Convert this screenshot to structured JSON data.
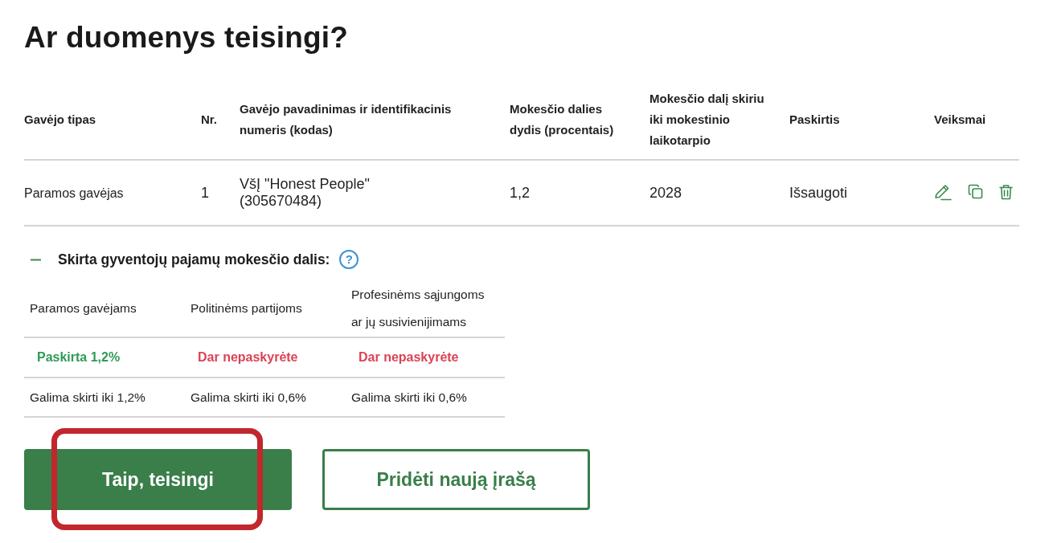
{
  "title": "Ar duomenys teisingi?",
  "table": {
    "columns": [
      "Gavėjo tipas",
      "Nr.",
      "Gavėjo pavadinimas ir identifikacinis numeris (kodas)",
      "Mokesčio dalies dydis (procentais)",
      "Mokesčio dalį skiriu iki mokestinio laikotarpio",
      "Paskirtis",
      "Veiksmai"
    ],
    "rows": [
      {
        "cells": [
          "Paramos gavėjas",
          "1",
          "VšĮ \"Honest People\"\n(305670484)",
          "1,2",
          "2028",
          "Išsaugoti"
        ]
      }
    ]
  },
  "allocation": {
    "expanded": true,
    "heading": "Skirta gyventojų pajamų mokesčio dalis:",
    "help": "?",
    "columns": [
      {
        "recipient": "Paramos gavėjams",
        "status": "Paskirta 1,2%",
        "color": "#2f9a55",
        "limit": "Galima skirti iki 1,2%"
      },
      {
        "recipient": "Politinėms partijoms",
        "status": "Dar nepaskyrėte",
        "color": "#db4256",
        "limit": "Galima skirti iki 0,6%"
      },
      {
        "recipient": "Profesinėms sąjungoms ar jų susivienijimams",
        "status": "Dar nepaskyrėte",
        "color": "#db4256",
        "limit": "Galima skirti iki 0,6%"
      }
    ]
  },
  "buttons": [
    {
      "label": "Taip, teisingi",
      "kind": "primary",
      "highlighted": true
    },
    {
      "label": "Pridėti naują įrašą",
      "kind": "secondary",
      "highlighted": false
    }
  ]
}
